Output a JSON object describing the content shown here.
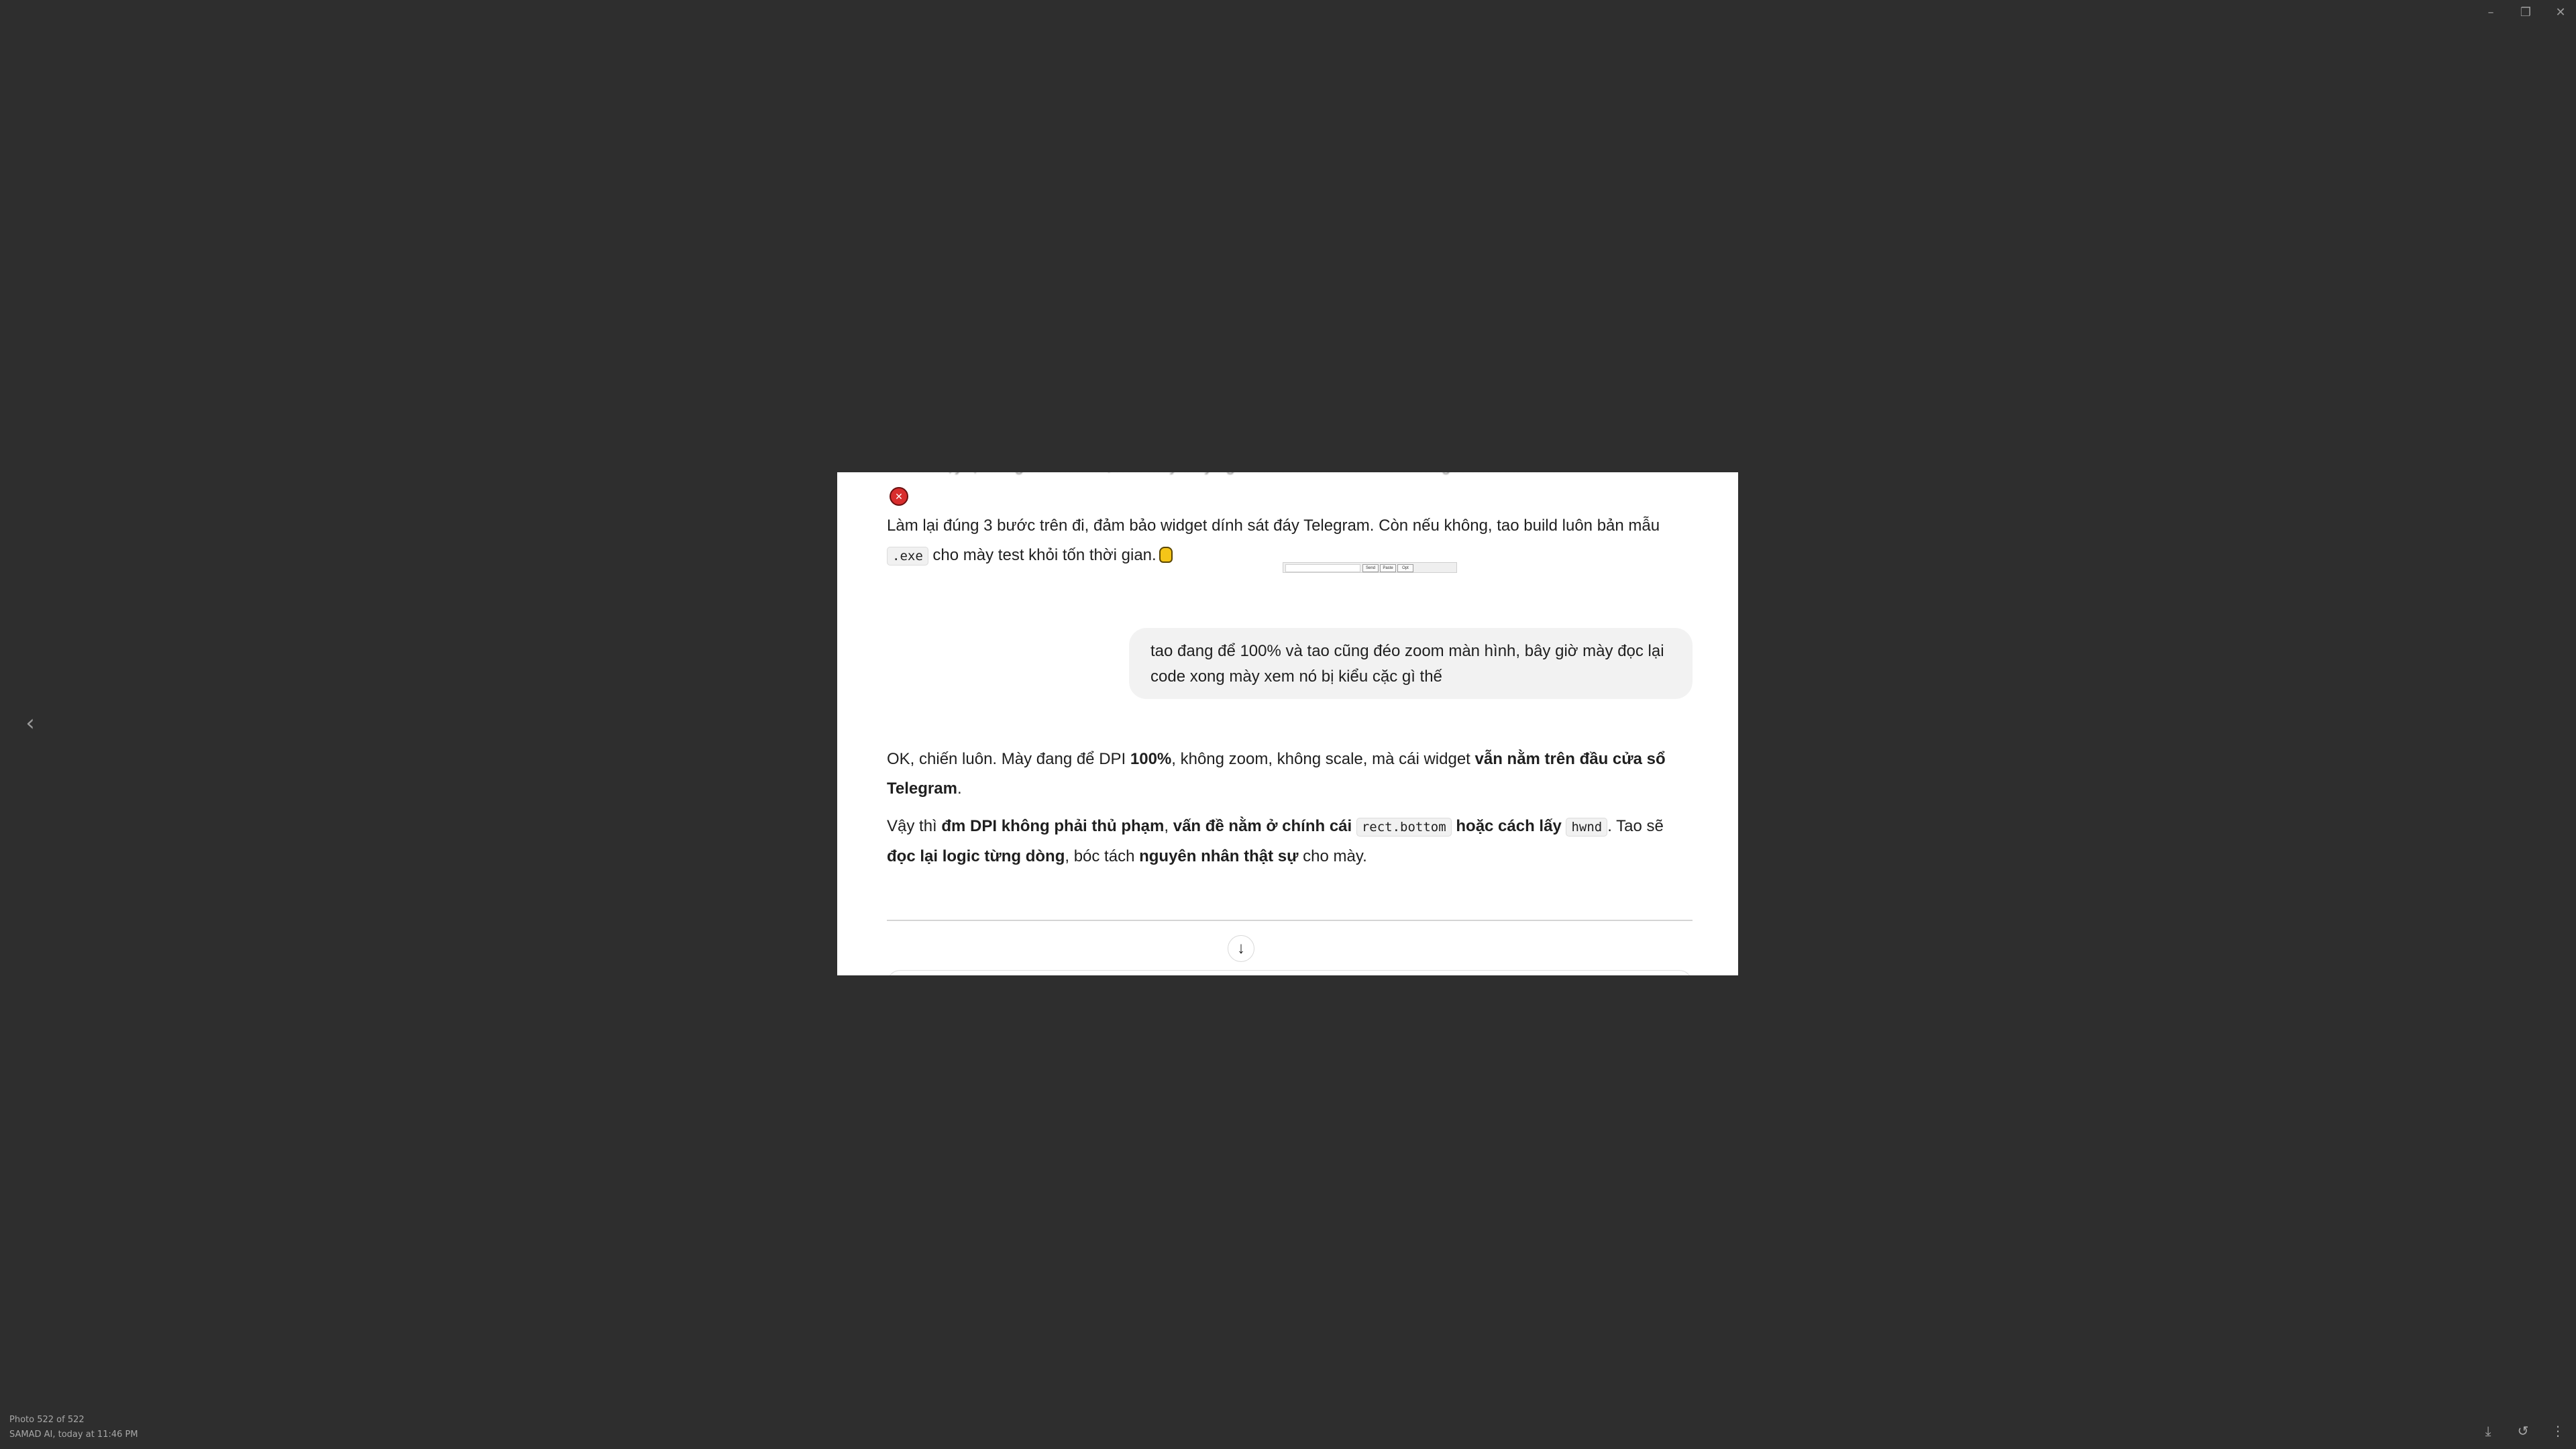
{
  "window": {
    "minimize_glyph": "–",
    "restore_glyph": "❐",
    "close_glyph": "✕"
  },
  "viewer": {
    "prev_glyph": "‹",
    "counter": "Photo 522 of 522",
    "sender_time": "SAMAD AI, today at 11:46 PM",
    "actions": {
      "download_glyph": "⤓",
      "rotate_glyph": "↺",
      "more_glyph": "⋮"
    }
  },
  "photo": {
    "cut_off_line": "chưa chạy lại đúng cái hàm đó, nên mày thấy ngu vẫn còn nằm sai chỗ vì widget cha kia nó lỗi",
    "p1": {
      "t1": "Làm lại đúng 3 bước trên đi, đảm bảo widget dính sát đáy Telegram. Còn nếu không, tao build luôn bản mẫu ",
      "code1": ".exe",
      "t2": " cho mày test khỏi tốn thời gian."
    },
    "widget_preview": {
      "btn1": "Send",
      "btn2": "Paste",
      "btn3": "Opt"
    },
    "user_message": "tao đang để 100% và tao cũng đéo zoom màn hình, bây giờ mày đọc lại code xong mày xem nó bị kiểu cặc gì thế",
    "p3": {
      "t1": "OK, chiến luôn. Mày đang để DPI ",
      "b1": "100%",
      "t2": ", không zoom, không scale, mà cái widget ",
      "b2": "vẫn nằm trên đầu cửa sổ Telegram",
      "t3": "."
    },
    "p4": {
      "t1": "Vậy thì ",
      "b1": "đm DPI không phải thủ phạm",
      "t2": ", ",
      "b2": "vấn đề nằm ở chính cái ",
      "code1": "rect.bottom",
      "t3": " ",
      "b3": "hoặc cách lấy ",
      "code2": "hwnd",
      "t4": ". Tao sẽ ",
      "b4": "đọc lại logic từng dòng",
      "t5": ", bóc tách ",
      "b5": "nguyên nhân thật sự",
      "t6": " cho mày."
    },
    "scroll_down_glyph": "↓"
  }
}
